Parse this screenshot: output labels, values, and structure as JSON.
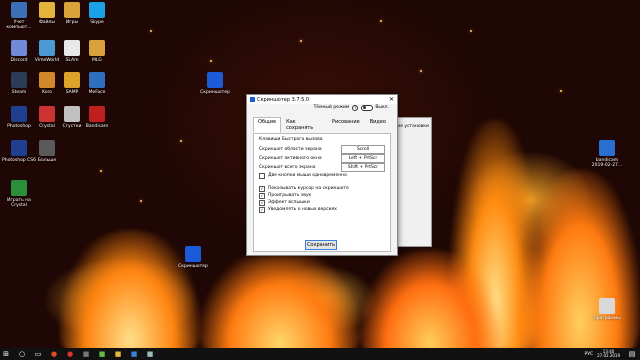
{
  "desktop": {
    "icons": [
      {
        "label": "Учет компьют...",
        "color": "#3b6fb6"
      },
      {
        "label": "Файлы",
        "color": "#e3b53d"
      },
      {
        "label": "Игры",
        "color": "#d9a23a"
      },
      {
        "label": "Skype",
        "color": "#1aa0e6"
      },
      {
        "label": "Discord",
        "color": "#7289da"
      },
      {
        "label": "VimeWorld",
        "color": "#4a9ad6"
      },
      {
        "label": "SLAm",
        "color": "#e8e8e8"
      },
      {
        "label": "MLG",
        "color": "#d9a23a"
      },
      {
        "label": "Steam",
        "color": "#2b3d55"
      },
      {
        "label": "Koro",
        "color": "#d08a2b"
      },
      {
        "label": "SAMP",
        "color": "#e0a32a"
      },
      {
        "label": "MeFace",
        "color": "#2e6fbf"
      },
      {
        "label": "Скриншотер",
        "color": "#1c5bd8"
      },
      {
        "label": "Photoshop",
        "color": "#1f3f8f"
      },
      {
        "label": "Crystal",
        "color": "#cc3333"
      },
      {
        "label": "Сгустки",
        "color": "#c0c0c0"
      },
      {
        "label": "Bandicam",
        "color": "#c01f1f"
      },
      {
        "label": "Photoshop CS6",
        "color": "#1f3f8f"
      },
      {
        "label": "Больше",
        "color": "#5a5a5a"
      },
      {
        "label": "Играть на Crystal",
        "color": "#2a8f3a"
      },
      {
        "label": "bandicam 2019-02-27...",
        "color": "#2a6fd0"
      },
      {
        "label": "Программы",
        "color": "#d9d9d9"
      },
      {
        "label": "Скриншотер",
        "color": "#1c5bd8"
      }
    ]
  },
  "window": {
    "title": "Скриншотер 3.7.5.0",
    "dark_mode_label": "Тёмный режим",
    "dark_mode_state": "Выкл.",
    "close_icon": "close-icon",
    "tabs": [
      "Общие",
      "Как сохранять",
      "Рисование",
      "Видео"
    ],
    "section_title": "Клавиши Быстрого вызова",
    "hotkeys": [
      {
        "label": "Скриншот области экрана",
        "key": "Scroll"
      },
      {
        "label": "Скриншот активного окна",
        "key": "Left + PrtScr"
      },
      {
        "label": "Скриншот всего экрана",
        "key": "Shift + PrtScr"
      }
    ],
    "checkboxes": [
      {
        "label": "Две кнопки мыши одновременно",
        "checked": false
      },
      {
        "label": "Показывать курсор на скриншоте",
        "checked": true
      },
      {
        "label": "Проигрывать звук",
        "checked": true
      },
      {
        "label": "Эффект вспышки",
        "checked": true
      },
      {
        "label": "Уведомлять о новых версиях",
        "checked": true
      }
    ],
    "save_button": "Сохранить"
  },
  "back_window": {
    "tab_label": "...ие установки"
  },
  "taskbar": {
    "lang": "РУС",
    "time": "13:40",
    "date": "27.02.2019"
  }
}
